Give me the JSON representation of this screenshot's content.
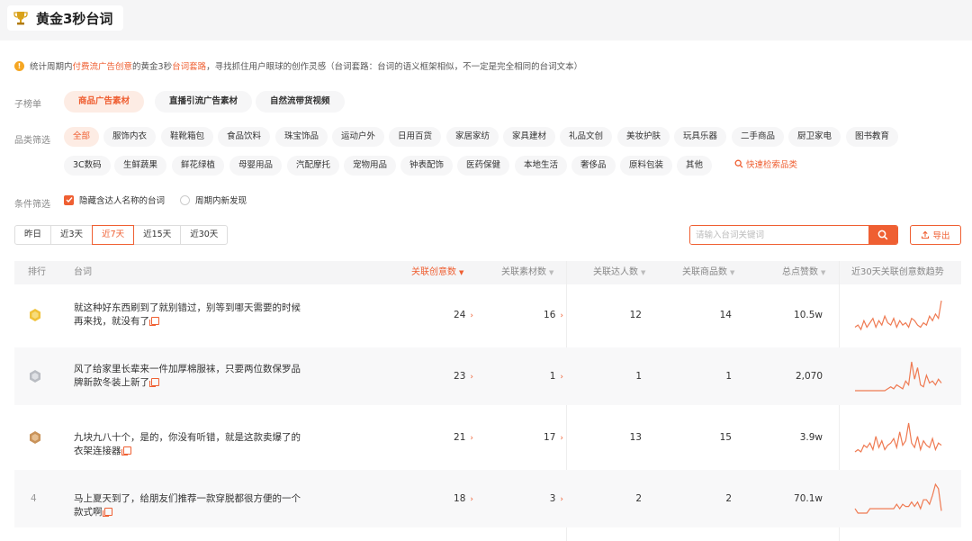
{
  "header": {
    "title": "黄金3秒台词",
    "icon": "trophy-icon"
  },
  "notice": {
    "prefix": "统计周期内",
    "link1": "付费流广告创意",
    "middle": "的黄金3秒",
    "link2": "台词套路",
    "suffix": "，寻找抓住用户眼球的创作灵感（台词套路：台词的语义框架相似，不一定是完全相同的台词文本）"
  },
  "subtabs": {
    "label": "子榜单",
    "items": [
      "商品广告素材",
      "直播引流广告素材",
      "自然流带货视频"
    ]
  },
  "categories": {
    "label": "品类筛选",
    "row1": [
      "全部",
      "服饰内衣",
      "鞋靴箱包",
      "食品饮料",
      "珠宝饰品",
      "运动户外",
      "日用百货",
      "家居家纺",
      "家具建材",
      "礼品文创",
      "美妆护肤",
      "玩具乐器",
      "二手商品",
      "厨卫家电",
      "图书教育"
    ],
    "row2": [
      "3C数码",
      "生鲜蔬果",
      "鲜花绿植",
      "母婴用品",
      "汽配摩托",
      "宠物用品",
      "钟表配饰",
      "医药保健",
      "本地生活",
      "奢侈品",
      "原料包装",
      "其他"
    ],
    "quick_search": "快速检索品类"
  },
  "conditions": {
    "label": "条件筛选",
    "hide_names": "隐藏含达人名称的台词",
    "new_in_period": "周期内新发现"
  },
  "periods": [
    "昨日",
    "近3天",
    "近7天",
    "近15天",
    "近30天"
  ],
  "search": {
    "placeholder": "请输入台词关键词"
  },
  "export_label": "导出",
  "table": {
    "headers": {
      "rank": "排行",
      "quote": "台词",
      "creatives": "关联创意数",
      "materials": "关联素材数",
      "influencers": "关联达人数",
      "products": "关联商品数",
      "likes": "总点赞数",
      "trend": "近30天关联创意数趋势"
    },
    "rows": [
      {
        "rank": "1",
        "rank_icon": "gold-medal-icon",
        "quote": "就这种好东西刷到了就别错过，别等到哪天需要的时候再来找，就没有了",
        "creatives": "24",
        "materials": "16",
        "influencers": "12",
        "products": "14",
        "likes": "10.5w",
        "trend": [
          2,
          3,
          1,
          5,
          2,
          4,
          6,
          2,
          5,
          3,
          7,
          4,
          3,
          6,
          2,
          5,
          3,
          4,
          2,
          6,
          5,
          3,
          2,
          4,
          3,
          7,
          5,
          8,
          6,
          14
        ]
      },
      {
        "rank": "2",
        "rank_icon": "silver-medal-icon",
        "quote": "风了给家里长辈来一件加厚棉服袜，只要两位数保罗品牌新款冬装上新了",
        "creatives": "23",
        "materials": "1",
        "influencers": "1",
        "products": "1",
        "likes": "2,070",
        "trend": [
          0,
          0,
          0,
          0,
          0,
          0,
          0,
          0,
          0,
          0,
          0,
          1,
          2,
          1,
          3,
          2,
          1,
          5,
          3,
          15,
          6,
          12,
          3,
          2,
          8,
          4,
          5,
          3,
          6,
          4
        ]
      },
      {
        "rank": "3",
        "rank_icon": "bronze-medal-icon",
        "quote": "九块九八十个，是的，你没有听错，就是这款卖爆了的衣架连接器",
        "creatives": "21",
        "materials": "17",
        "influencers": "13",
        "products": "15",
        "likes": "3.9w",
        "trend": [
          1,
          2,
          1,
          4,
          3,
          5,
          2,
          8,
          3,
          6,
          2,
          4,
          5,
          7,
          3,
          10,
          4,
          6,
          14,
          5,
          3,
          8,
          2,
          6,
          4,
          3,
          7,
          2,
          5,
          4
        ]
      },
      {
        "rank": "4",
        "rank_icon": "",
        "quote": "马上夏天到了，给朋友们推荐一款穿脱都很方便的一个款式啊",
        "creatives": "18",
        "materials": "3",
        "influencers": "2",
        "products": "2",
        "likes": "70.1w",
        "trend": [
          3,
          1,
          1,
          1,
          1,
          3,
          3,
          3,
          3,
          3,
          3,
          3,
          3,
          3,
          5,
          3,
          5,
          4,
          4,
          6,
          4,
          6,
          3,
          7,
          7,
          5,
          9,
          14,
          12,
          2
        ]
      }
    ]
  },
  "colors": {
    "accent": "#ef5f32",
    "header_bg": "#f5f5f6",
    "row_alt": "#f8f8f9"
  }
}
